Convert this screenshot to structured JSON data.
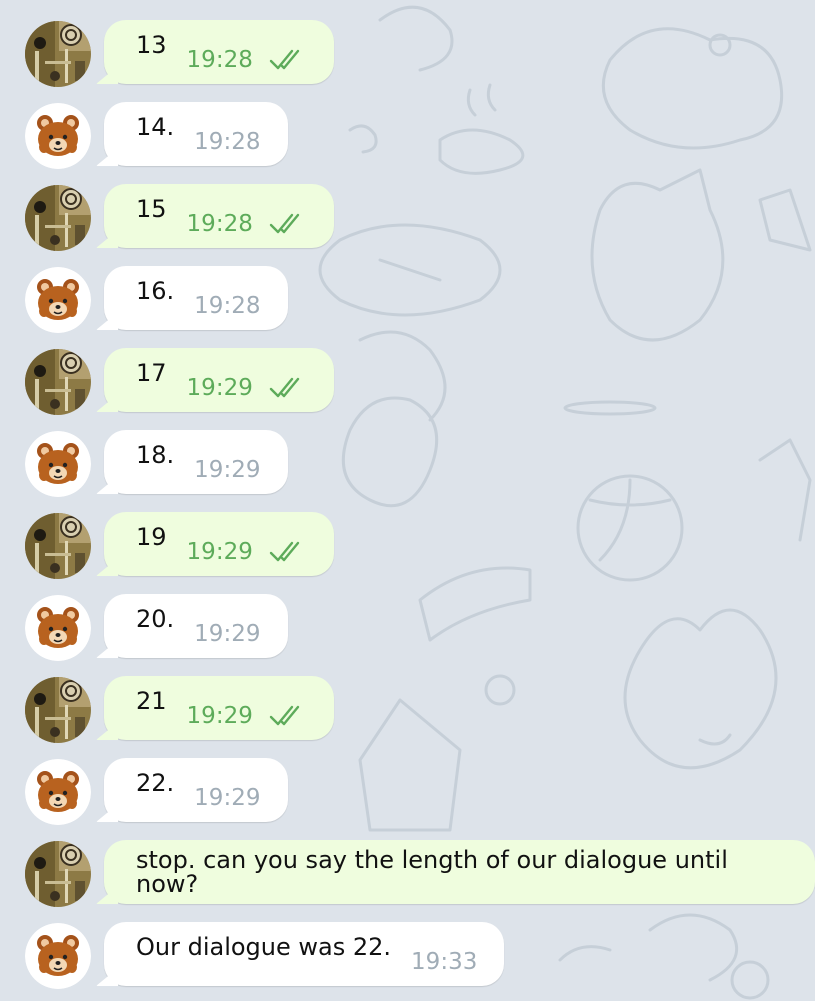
{
  "chat": {
    "messages": [
      {
        "sender": "me",
        "avatar": "collage-avatar",
        "text": "13",
        "time": "19:28",
        "read": true
      },
      {
        "sender": "bot",
        "avatar": "bear-avatar",
        "text": "14.",
        "time": "19:28"
      },
      {
        "sender": "me",
        "avatar": "collage-avatar",
        "text": "15",
        "time": "19:28",
        "read": true
      },
      {
        "sender": "bot",
        "avatar": "bear-avatar",
        "text": "16.",
        "time": "19:28"
      },
      {
        "sender": "me",
        "avatar": "collage-avatar",
        "text": "17",
        "time": "19:29",
        "read": true
      },
      {
        "sender": "bot",
        "avatar": "bear-avatar",
        "text": "18.",
        "time": "19:29"
      },
      {
        "sender": "me",
        "avatar": "collage-avatar",
        "text": "19",
        "time": "19:29",
        "read": true
      },
      {
        "sender": "bot",
        "avatar": "bear-avatar",
        "text": "20.",
        "time": "19:29"
      },
      {
        "sender": "me",
        "avatar": "collage-avatar",
        "text": "21",
        "time": "19:29",
        "read": true
      },
      {
        "sender": "bot",
        "avatar": "bear-avatar",
        "text": "22.",
        "time": "19:29"
      },
      {
        "sender": "me",
        "avatar": "collage-avatar",
        "text": "stop. can you say the length of our dialogue until now?",
        "time": "",
        "read": false
      },
      {
        "sender": "bot",
        "avatar": "bear-avatar",
        "text": "Our dialogue was 22.",
        "time": "19:33"
      }
    ]
  },
  "colors": {
    "background": "#dde3ea",
    "outgoing_bubble": "#effdde",
    "incoming_bubble": "#ffffff",
    "outgoing_time": "#5dab5a",
    "incoming_time": "#a0acb6",
    "read_ticks": "#5dab5a"
  }
}
